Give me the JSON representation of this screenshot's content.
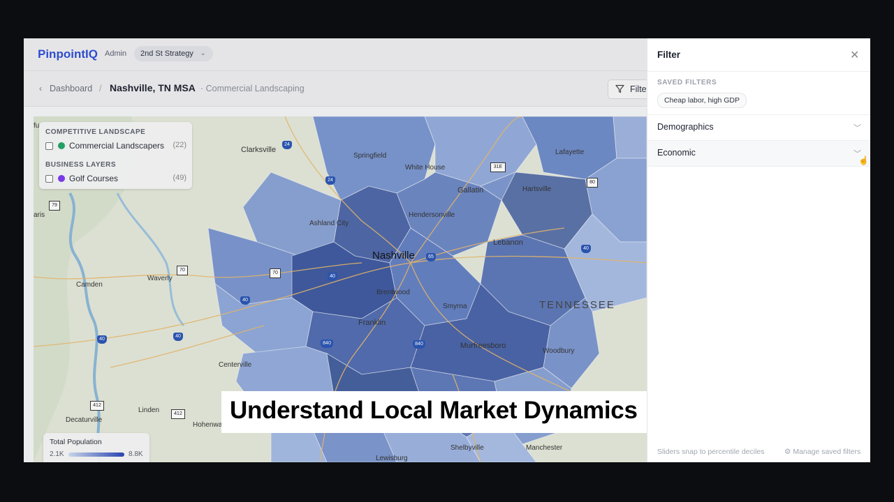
{
  "app": {
    "logo": "PinpointIQ",
    "role": "Admin",
    "strategy": "2nd St Strategy",
    "chevron_icon": "chevron-down-icon"
  },
  "breadcrumb": {
    "back_icon": "chevron-left-icon",
    "parent": "Dashboard",
    "separator": "/",
    "current": "Nashville, TN MSA",
    "subtitle": "· Commercial Landscaping",
    "filter_button": "Filter"
  },
  "map": {
    "legend": {
      "section1": "COMPETITIVE LANDSCAPE",
      "item1_label": "Commercial Landscapers",
      "item1_count": "(22)",
      "item1_color": "#22a565",
      "section2": "BUSINESS LAYERS",
      "item2_label": "Golf Courses",
      "item2_count": "(49)",
      "item2_color": "#7c3aed"
    },
    "population": {
      "title": "Total Population",
      "min": "2.1K",
      "max": "8.8K"
    },
    "labels": {
      "clarksville": "Clarksville",
      "springfield": "Springfield",
      "white_house": "White House",
      "lafayette": "Lafayette",
      "hartsville": "Hartsville",
      "gallatin": "Gallatin",
      "hendersonville": "Hendersonville",
      "ashland_city": "Ashland City",
      "nashville": "Nashville",
      "lebanon": "Lebanon",
      "camden": "Camden",
      "waverly": "Waverly",
      "brentwood": "Brentwood",
      "smyrna": "Smyrna",
      "tennessee": "TENNESSEE",
      "franklin": "Franklin",
      "murfreesboro": "Murfreesboro",
      "woodbury": "Woodbury",
      "centerville": "Centerville",
      "linden": "Linden",
      "decaturville": "Decaturville",
      "hohenwald": "Hohenwald",
      "shelbyville": "Shelbyville",
      "manchester": "Manchester",
      "lewisburg": "Lewisburg",
      "paris": "aris",
      "edge_text": "fu"
    },
    "shields": {
      "s24a": "24",
      "s24b": "24",
      "s31e": "31E",
      "s80": "80",
      "s79": "79",
      "s65": "65",
      "s40a": "40",
      "s40b": "40",
      "s40c": "40",
      "s40d": "40",
      "s40e": "40",
      "s70": "70",
      "s840a": "840",
      "s840b": "840",
      "s412a": "412",
      "s412b": "412"
    }
  },
  "filter_panel": {
    "title": "Filter",
    "close_icon": "close-icon",
    "saved_heading": "SAVED FILTERS",
    "saved_chip": "Cheap labor, high GDP",
    "sections": [
      {
        "label": "Demographics"
      },
      {
        "label": "Economic"
      }
    ],
    "footer_left": "Sliders snap to percentile deciles",
    "footer_right": "Manage saved filters"
  },
  "caption": "Understand Local Market Dynamics"
}
